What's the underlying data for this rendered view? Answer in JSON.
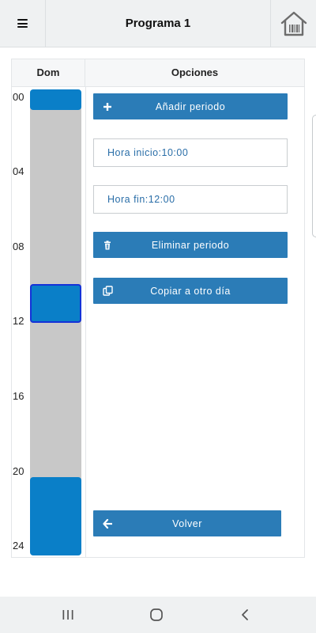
{
  "header": {
    "title": "Programa 1",
    "menu_icon": "hamburger-menu-icon",
    "home_icon": "home-barcode-icon"
  },
  "table": {
    "day_header": "Dom",
    "options_header": "Opciones",
    "hours": [
      "00",
      "04",
      "08",
      "12",
      "16",
      "20",
      "24"
    ]
  },
  "schedule": {
    "periods": [
      {
        "start": "00:00",
        "end": "01:00",
        "selected": false
      },
      {
        "start": "10:00",
        "end": "12:00",
        "selected": true
      },
      {
        "start": "20:00",
        "end": "24:00",
        "selected": false
      }
    ]
  },
  "options": {
    "add_label": "Añadir periodo",
    "start_field": "Hora inicio:10:00",
    "end_field": "Hora fin:12:00",
    "delete_label": "Eliminar periodo",
    "copy_label": "Copiar a otro día",
    "back_label": "Volver"
  },
  "colors": {
    "accent": "#2b7cb7",
    "period": "#0a7fc8",
    "selected_border": "#1432d8",
    "track": "#c8c8c8"
  },
  "navbar": {
    "recents_icon": "recent-apps-icon",
    "home_icon": "home-circle-icon",
    "back_icon": "back-chevron-icon"
  }
}
